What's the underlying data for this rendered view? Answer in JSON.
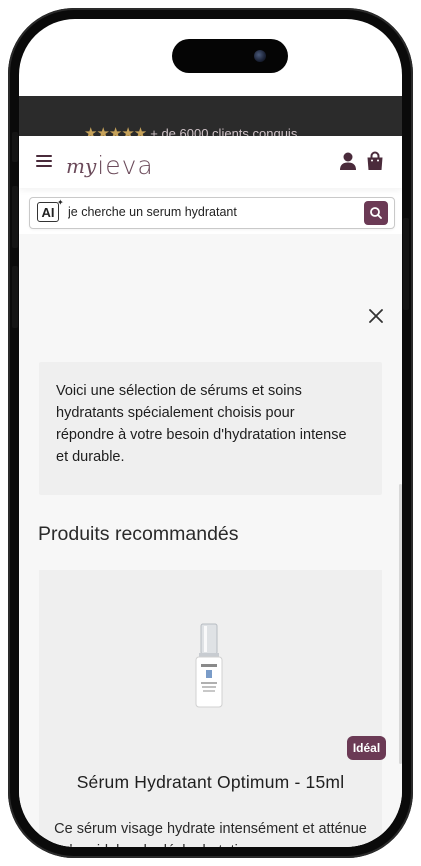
{
  "promo": {
    "stars": "★★★★★",
    "text": "+ de 6000 clients conquis"
  },
  "header": {
    "logo_script": "my",
    "logo_word": "ieva",
    "icons": [
      "menu-icon",
      "user-icon",
      "shopping-bag-icon"
    ]
  },
  "search": {
    "ai_label": "AI",
    "value": "je cherche un serum hydratant",
    "button_icon": "search-icon"
  },
  "results": {
    "intro": "Voici une sélection de sérums et soins hydratants spécialement choisis pour répondre à votre besoin d'hydratation intense et durable.",
    "section_title": "Produits recommandés",
    "close_icon": "close-icon"
  },
  "product": {
    "badge": "Idéal",
    "name": "Sérum Hydratant Optimum - 15ml",
    "description": "Ce sérum visage hydrate intensément et atténue les ridules de déshydratation pour une peau souple et éclatante."
  },
  "colors": {
    "brand": "#6b3a55",
    "promo_bg": "#2b2b2b",
    "stars": "#c6a25a",
    "panel_bg": "#f7f7f7",
    "card_bg": "#efefef"
  }
}
